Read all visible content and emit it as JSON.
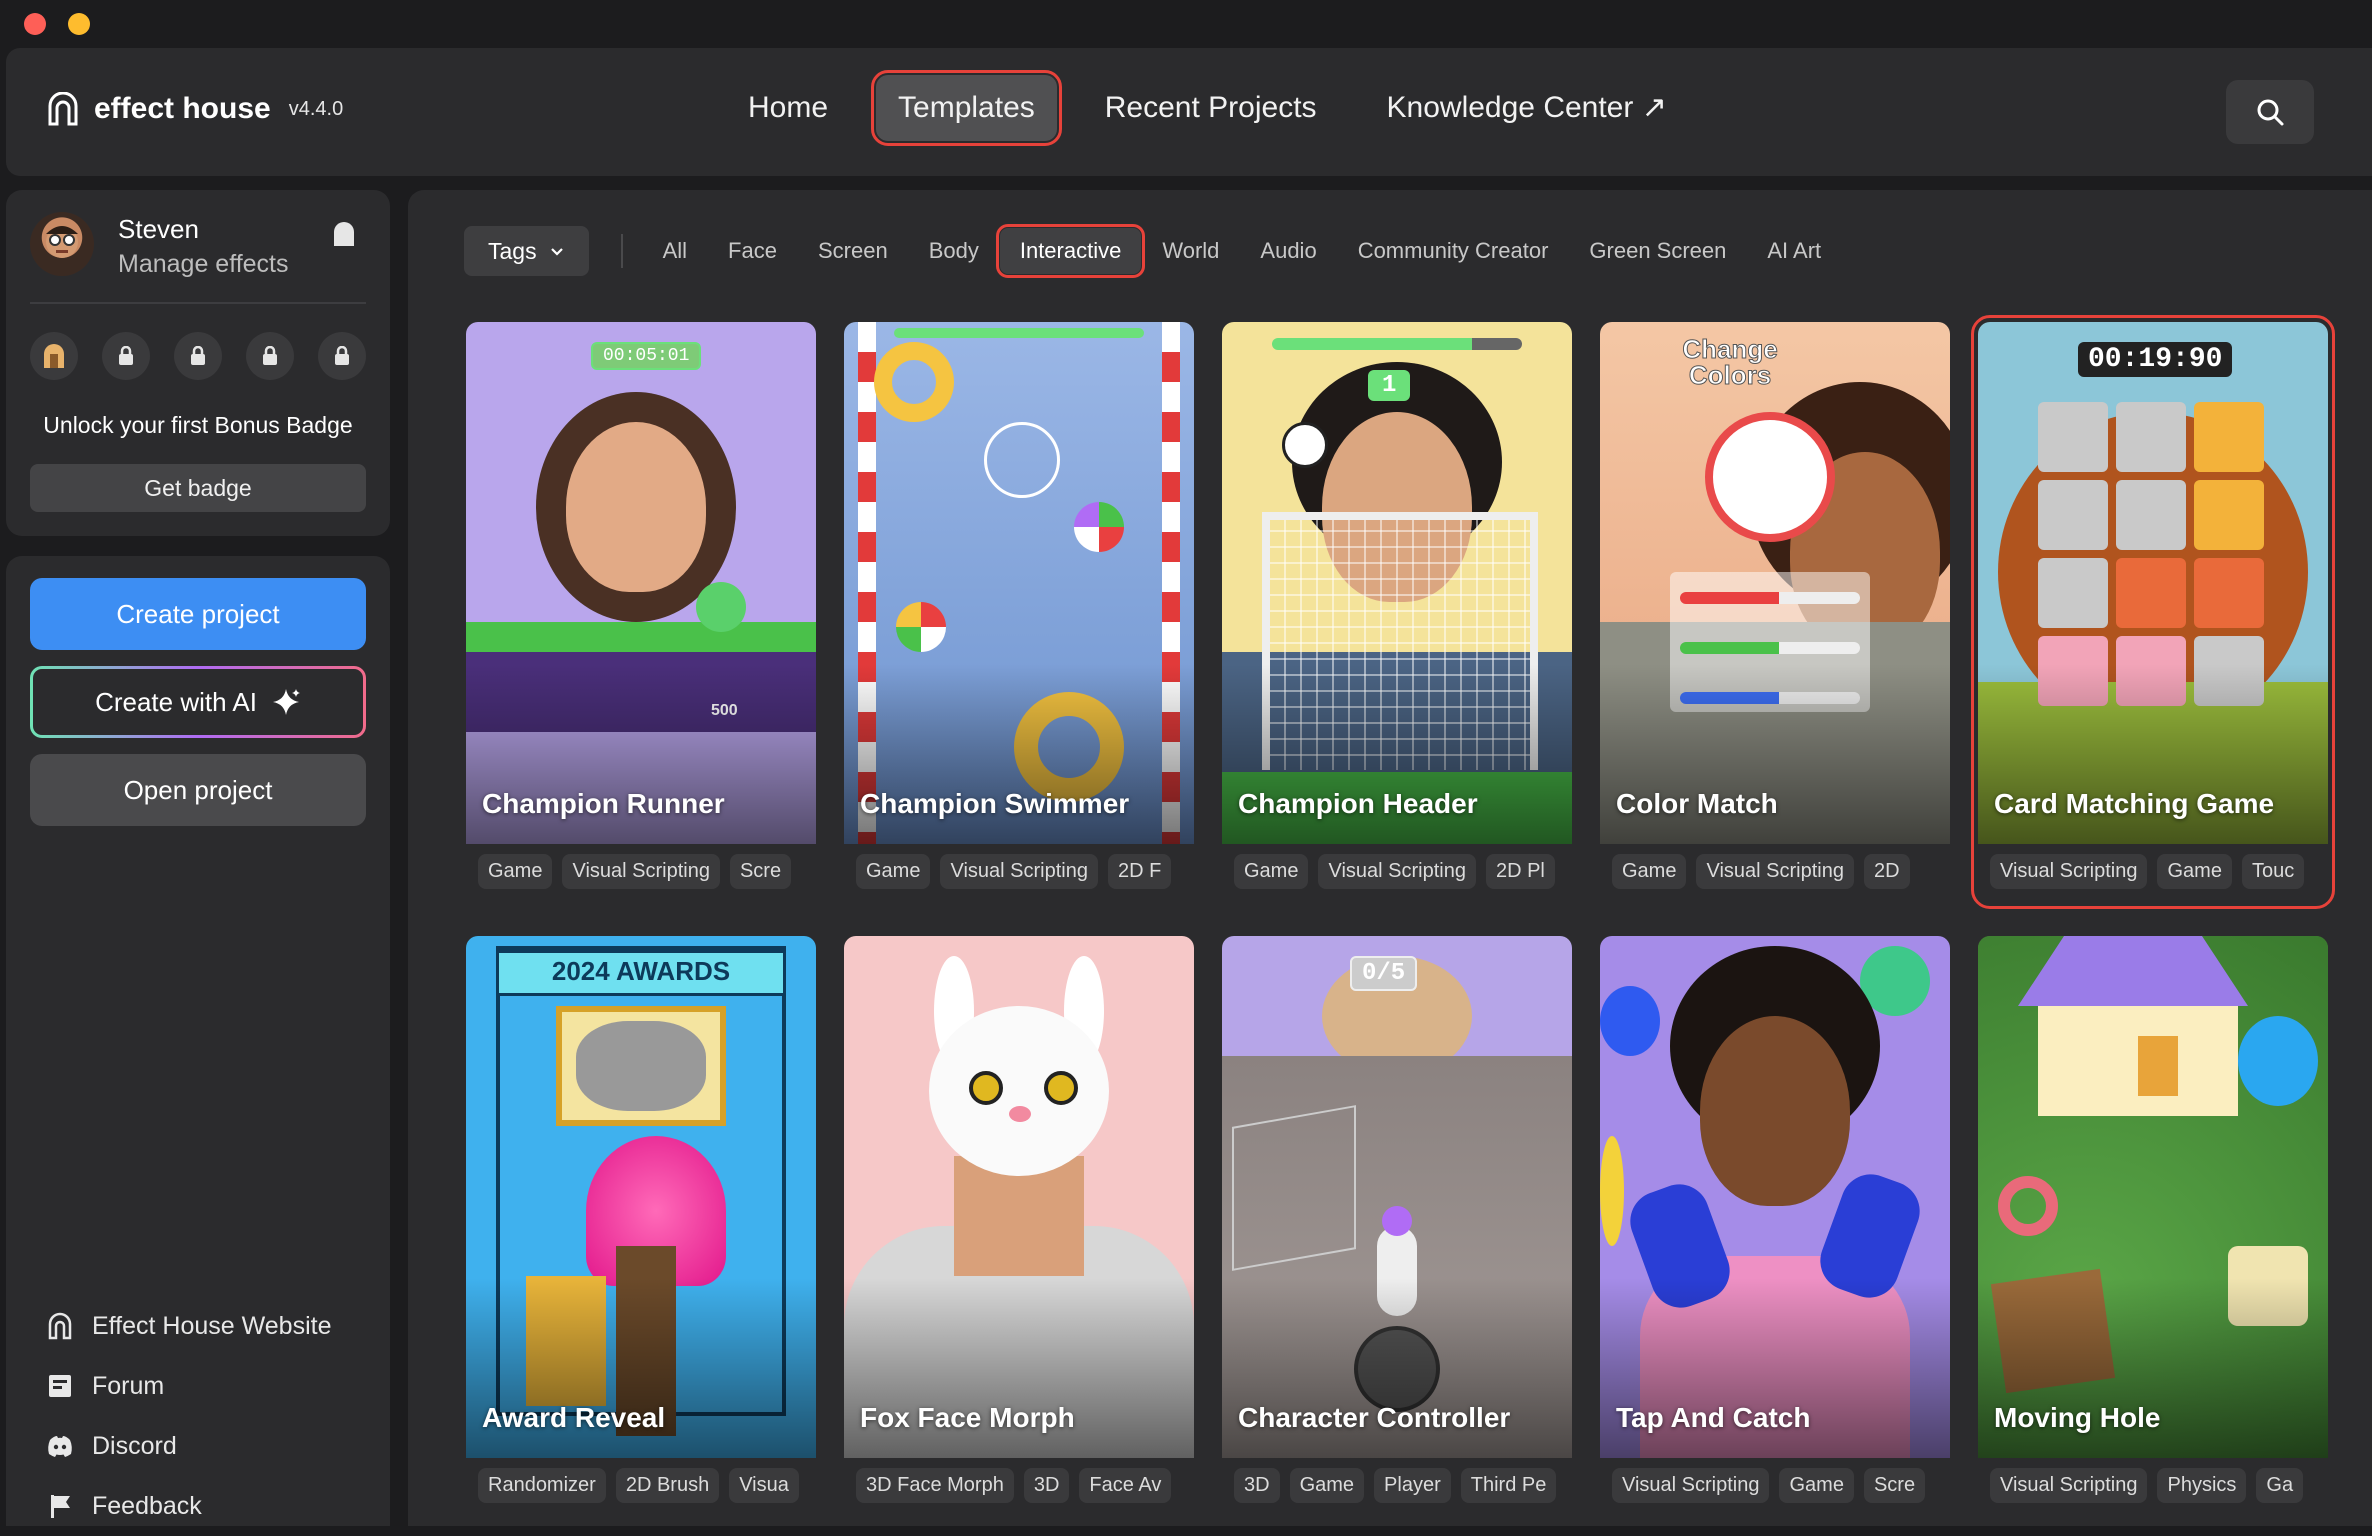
{
  "app": {
    "name": "effect house",
    "version": "v4.4.0"
  },
  "nav": {
    "items": [
      "Home",
      "Templates",
      "Recent Projects",
      "Knowledge Center ↗"
    ],
    "active": "Templates"
  },
  "user": {
    "name": "Steven",
    "subtitle": "Manage effects",
    "unlock_text": "Unlock your first Bonus Badge",
    "get_badge_label": "Get badge"
  },
  "actions": {
    "create_project": "Create project",
    "create_with_ai": "Create with AI",
    "open_project": "Open project"
  },
  "links": [
    {
      "label": "Effect House Website",
      "icon": "house-icon"
    },
    {
      "label": "Forum",
      "icon": "forum-icon"
    },
    {
      "label": "Discord",
      "icon": "discord-icon"
    },
    {
      "label": "Feedback",
      "icon": "flag-icon"
    }
  ],
  "filters": {
    "tags_label": "Tags",
    "items": [
      "All",
      "Face",
      "Screen",
      "Body",
      "Interactive",
      "World",
      "Audio",
      "Community Creator",
      "Green Screen",
      "AI Art"
    ],
    "active": "Interactive"
  },
  "templates": [
    {
      "title": "Champion Runner",
      "tags": [
        "Game",
        "Visual Scripting",
        "Scre"
      ],
      "overlay": "00:05:01",
      "score": "500"
    },
    {
      "title": "Champion Swimmer",
      "tags": [
        "Game",
        "Visual Scripting",
        "2D F"
      ]
    },
    {
      "title": "Champion Header",
      "tags": [
        "Game",
        "Visual Scripting",
        "2D Pl"
      ],
      "overlay": "1"
    },
    {
      "title": "Color Match",
      "tags": [
        "Game",
        "Visual Scripting",
        "2D"
      ],
      "overlay": "Change Colors"
    },
    {
      "title": "Card Matching Game",
      "tags": [
        "Visual Scripting",
        "Game",
        "Touc"
      ],
      "overlay": "00:19:90"
    },
    {
      "title": "Award Reveal",
      "tags": [
        "Randomizer",
        "2D Brush",
        "Visua"
      ],
      "overlay": "2024 AWARDS"
    },
    {
      "title": "Fox Face Morph",
      "tags": [
        "3D Face Morph",
        "3D",
        "Face Av"
      ]
    },
    {
      "title": "Character Controller",
      "tags": [
        "3D",
        "Game",
        "Player",
        "Third Pe"
      ],
      "overlay": "0/5"
    },
    {
      "title": "Tap And Catch",
      "tags": [
        "Visual Scripting",
        "Game",
        "Scre"
      ]
    },
    {
      "title": "Moving Hole",
      "tags": [
        "Visual Scripting",
        "Physics",
        "Ga"
      ]
    }
  ],
  "colors": {
    "accent_blue": "#3d8ef3",
    "highlight_red": "#e7423a",
    "background": "#1c1c1e",
    "panel": "#2b2b2d"
  }
}
